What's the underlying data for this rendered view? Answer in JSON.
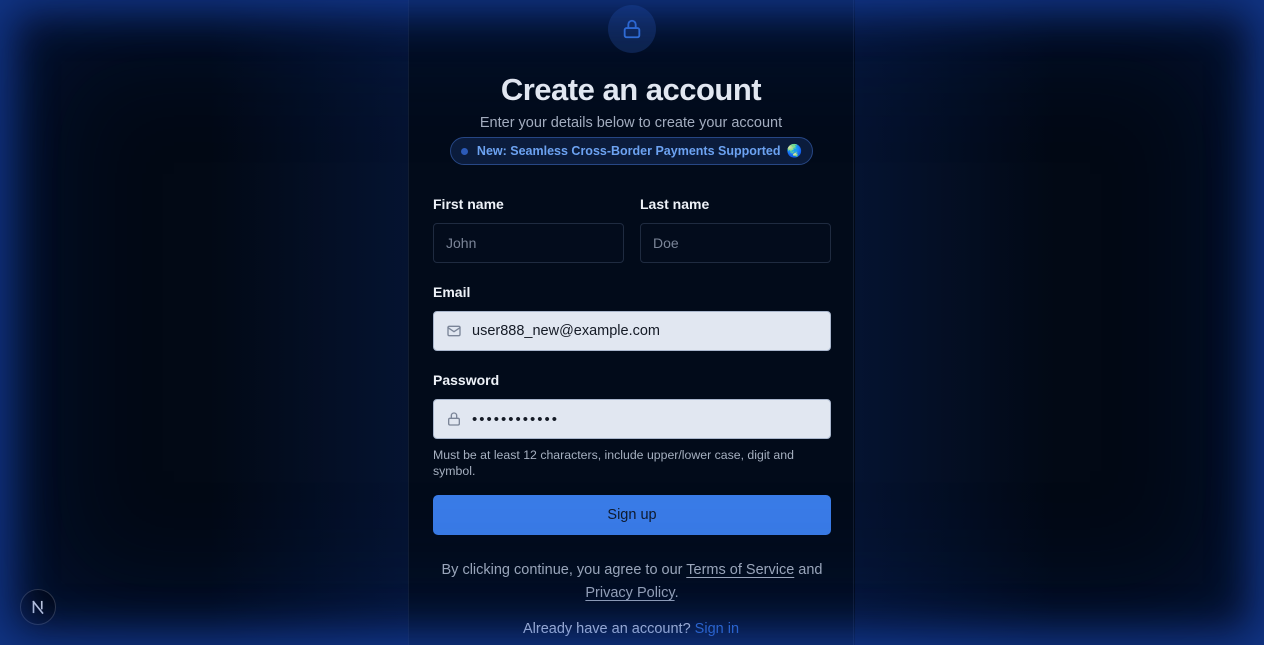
{
  "header": {
    "title": "Create an account",
    "subtitle": "Enter your details below to create your account",
    "announcement": "New: Seamless Cross-Border Payments Supported",
    "announcement_emoji": "🌏"
  },
  "form": {
    "first_name": {
      "label": "First name",
      "placeholder": "John",
      "value": ""
    },
    "last_name": {
      "label": "Last name",
      "placeholder": "Doe",
      "value": ""
    },
    "email": {
      "label": "Email",
      "value": "user888_new@example.com",
      "icon": "mail-icon"
    },
    "password": {
      "label": "Password",
      "value": "Abcdef123456",
      "icon": "lock-icon",
      "hint": "Must be at least 12 characters, include upper/lower case, digit and symbol."
    },
    "submit_label": "Sign up"
  },
  "legal": {
    "prefix": "By clicking continue, you agree to our",
    "terms_label": "Terms of Service",
    "conjunction": "and",
    "privacy_label": "Privacy Policy",
    "suffix": "."
  },
  "signin": {
    "prompt": "Already have an account?",
    "link_label": "Sign in"
  },
  "dev_badge": {
    "letter": "N",
    "icon": "nextjs-logo-icon"
  },
  "colors": {
    "background": "#020915",
    "panel": "#020b1a",
    "accent": "#3a7ce8",
    "pill_text": "#6da3f2",
    "input_filled": "#e1e7f1"
  }
}
